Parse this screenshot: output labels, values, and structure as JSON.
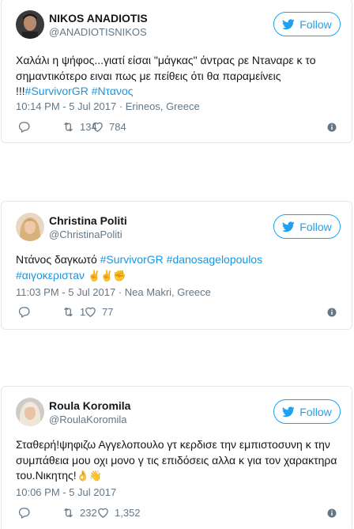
{
  "follow_label": "Follow",
  "tweets": [
    {
      "display_name": "NIKOS ANADIOTIS",
      "screen_name": "@ANADIOTISNIKOS",
      "text_plain": "Χαλάλι η ψήφος...γιατί είσαι \"μάγκας\" άντρας ρε Ντaναρε κ το σημαντικότερο ειναι πως με πείθεις ότι θα παραμείνεις !!!",
      "hashtags": [
        "#SurvivorGR",
        "#Ντανος"
      ],
      "timestamp": "10:14 PM - 5 Jul 2017",
      "location": "Erineos, Greece",
      "retweets": "134",
      "likes": "784"
    },
    {
      "display_name": "Christina Politi",
      "screen_name": "@ChristinaPoliti",
      "text_plain": "Ντάνος δαγκωτό",
      "hashtags": [
        "#SurvivorGR",
        "#danosagelopoulos",
        "#αιγοκεριστaν"
      ],
      "emojis": "✌✌✊",
      "timestamp": "11:03 PM - 5 Jul 2017",
      "location": "Nea Makri, Greece",
      "retweets": "1",
      "likes": "77"
    },
    {
      "display_name": "Roula Koromila",
      "screen_name": "@RoulaKoromila",
      "text_plain": "Σταθερή!ψηφιζω Αγγελοπουλο γτ κερδισε την εμπιστοσυνη κ την συμπάθεια μου οχι μονο γ τις επιδόσεις αλλα κ για τον χαρακτηρα του.Νικητης!",
      "emojis": "👌👋",
      "timestamp": "10:06 PM - 5 Jul 2017",
      "retweets": "232",
      "likes": "1,352"
    }
  ]
}
